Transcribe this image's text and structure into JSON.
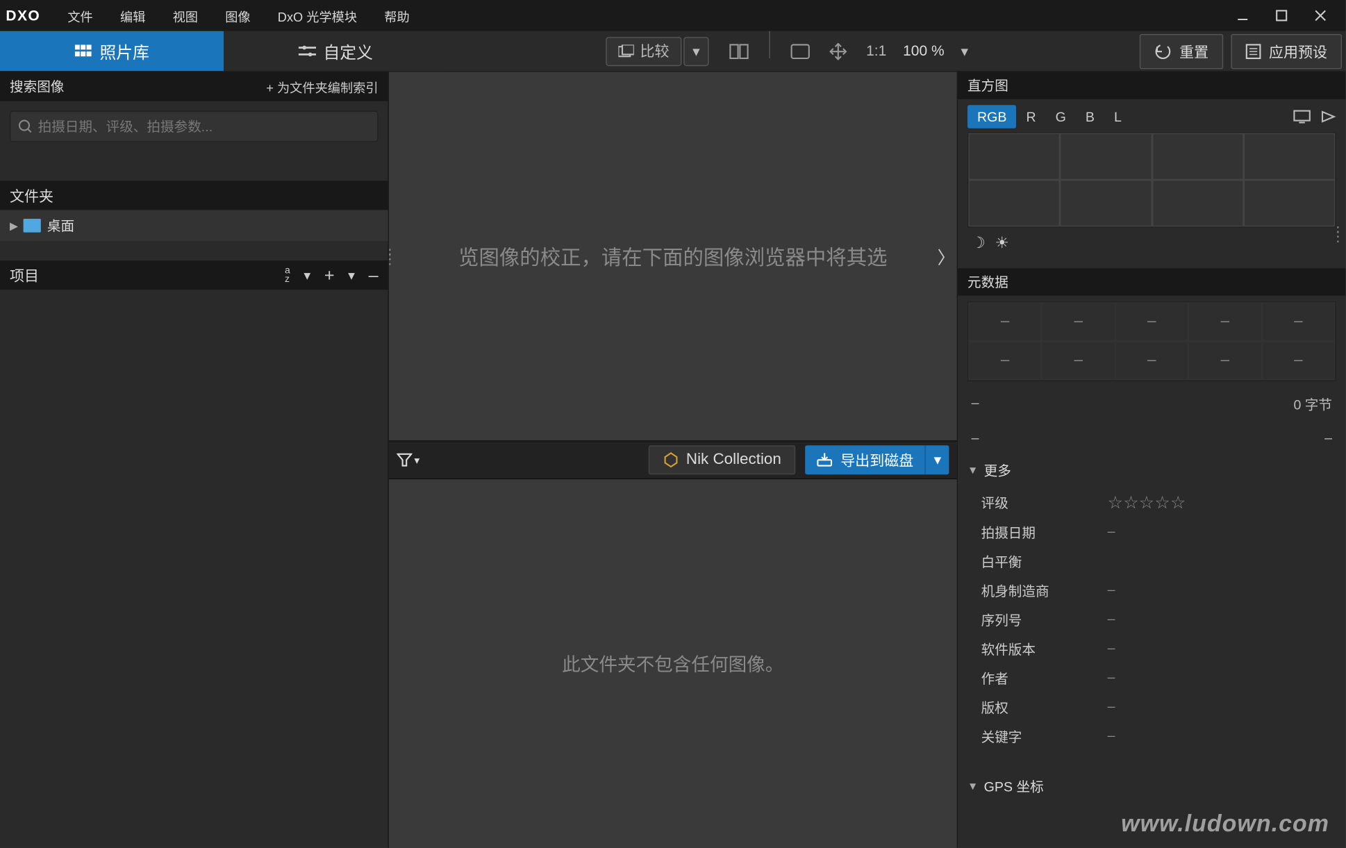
{
  "app": {
    "logo": "DXO"
  },
  "menu": [
    "文件",
    "编辑",
    "视图",
    "图像",
    "DxO 光学模块",
    "帮助"
  ],
  "tabs": {
    "library": "照片库",
    "custom": "自定义"
  },
  "toolbar": {
    "compare": "比较",
    "one_to_one": "1:1",
    "zoom": "100 %",
    "reset": "重置",
    "apply_preset": "应用预设"
  },
  "left": {
    "search_header": "搜索图像",
    "index_link": "+ 为文件夹编制索引",
    "search_placeholder": "拍摄日期、评级、拍摄参数...",
    "folders_header": "文件夹",
    "folder_desktop": "桌面",
    "projects_header": "项目",
    "sort_icon": "a\nz"
  },
  "center": {
    "viewer_hint": "览图像的校正，请在下面的图像浏览器中将其选",
    "nik": "Nik Collection",
    "export": "导出到磁盘",
    "empty": "此文件夹不包含任何图像。"
  },
  "right": {
    "histogram_header": "直方图",
    "hist_tabs": [
      "RGB",
      "R",
      "G",
      "B",
      "L"
    ],
    "metadata_header": "元数据",
    "bytes": "0 字节",
    "more": "更多",
    "rating_label": "评级",
    "fields": [
      {
        "k": "拍摄日期",
        "v": "–"
      },
      {
        "k": "白平衡",
        "v": ""
      },
      {
        "k": "机身制造商",
        "v": "–"
      },
      {
        "k": "序列号",
        "v": "–"
      },
      {
        "k": "软件版本",
        "v": "–"
      },
      {
        "k": "作者",
        "v": "–"
      },
      {
        "k": "版权",
        "v": "–"
      },
      {
        "k": "关键字",
        "v": "–"
      }
    ],
    "gps_header": "GPS 坐标"
  },
  "watermark": "www.ludown.com"
}
